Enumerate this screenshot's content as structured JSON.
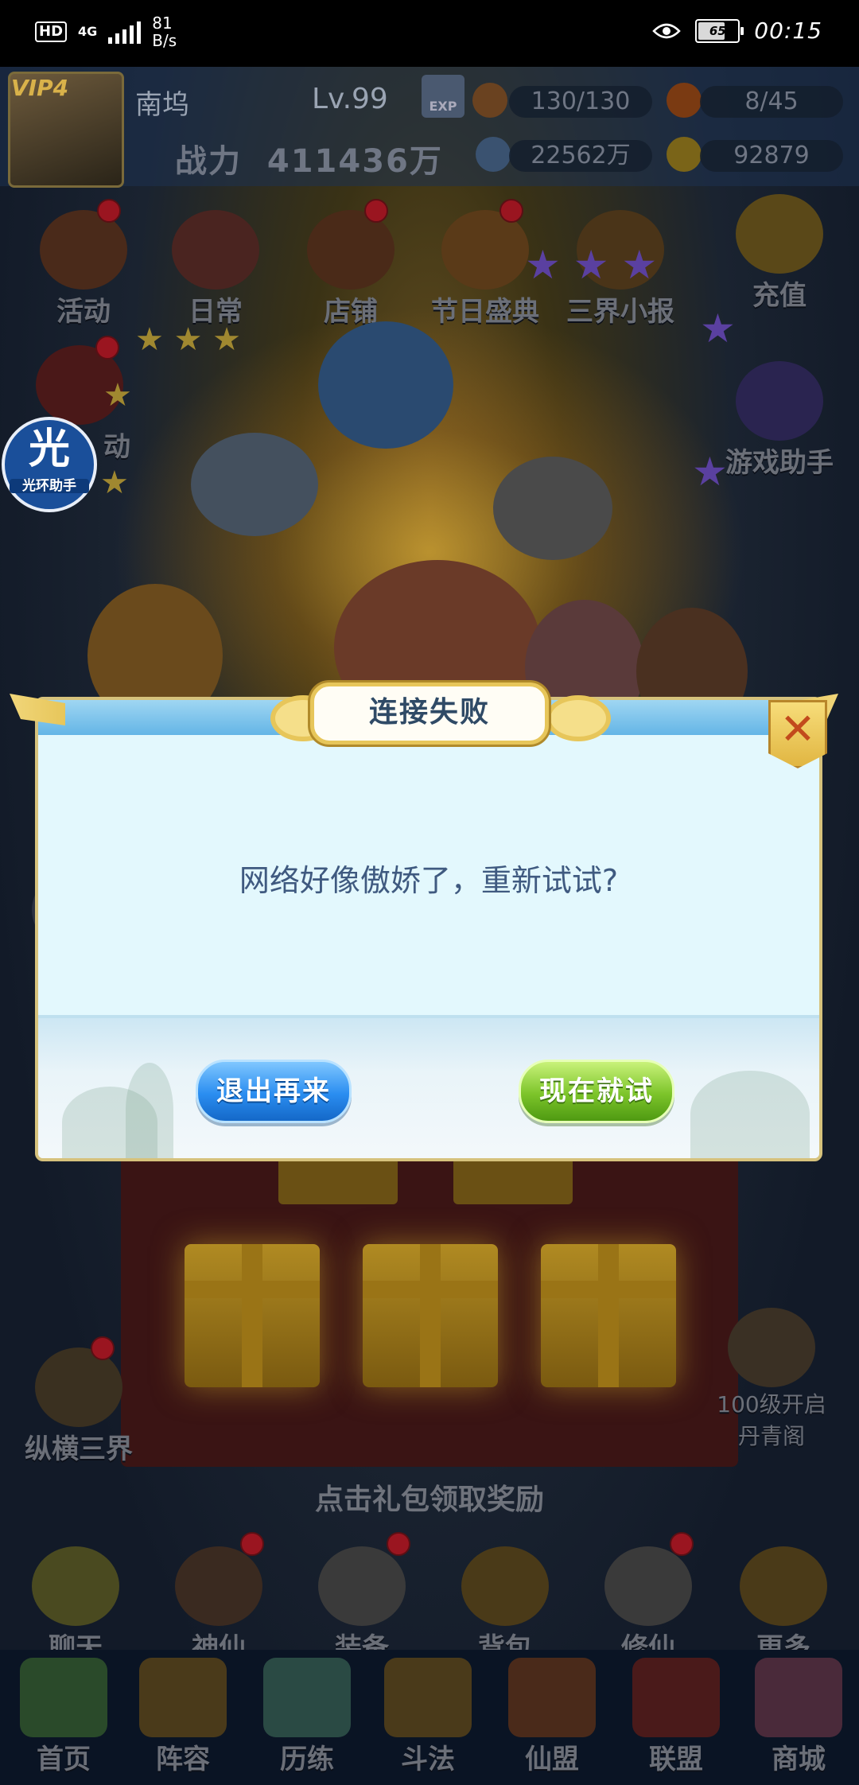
{
  "status_bar": {
    "hd": "HD",
    "network": "4G",
    "speed_value": "81",
    "speed_unit": "B/s",
    "battery_level": "65",
    "time": "00:15"
  },
  "player": {
    "vip": "VIP4",
    "name": "南坞",
    "level": "Lv.99",
    "power_label": "战力",
    "power_value": "411436万",
    "energy": "130/130",
    "fire": "8/45",
    "silver": "22562万",
    "gold": "92879",
    "exp_label": "EXP"
  },
  "top_icons": [
    "活动",
    "日常",
    "店铺",
    "节日盛典",
    "三界小报",
    "充值"
  ],
  "side_icons": {
    "left_partial": "动",
    "game_helper": "游戏助手",
    "zongheng": "纵横三界",
    "unlock_line1": "100级开启",
    "unlock_line2": "丹青阁"
  },
  "floating_helper": {
    "glyph": "光",
    "label": "光环助手"
  },
  "gift_hint": "点击礼包领取奖励",
  "func_bar": [
    "聊天",
    "神仙",
    "装备",
    "背包",
    "修仙",
    "更多"
  ],
  "bottom_nav": [
    "首页",
    "阵容",
    "历练",
    "斗法",
    "仙盟",
    "联盟",
    "商城"
  ],
  "dialog": {
    "title": "连接失败",
    "message": "网络好像傲娇了，重新试试?",
    "exit_button": "退出再来",
    "retry_button": "现在就试",
    "close_glyph": "✕"
  },
  "colors": {
    "dialog_bg": "#e3f8fd",
    "title_text": "#2f4a66",
    "message_text": "#3f5a80",
    "exit_button": "#2a8df0",
    "retry_button": "#7cc42a",
    "gold_border": "#e7c65a"
  }
}
